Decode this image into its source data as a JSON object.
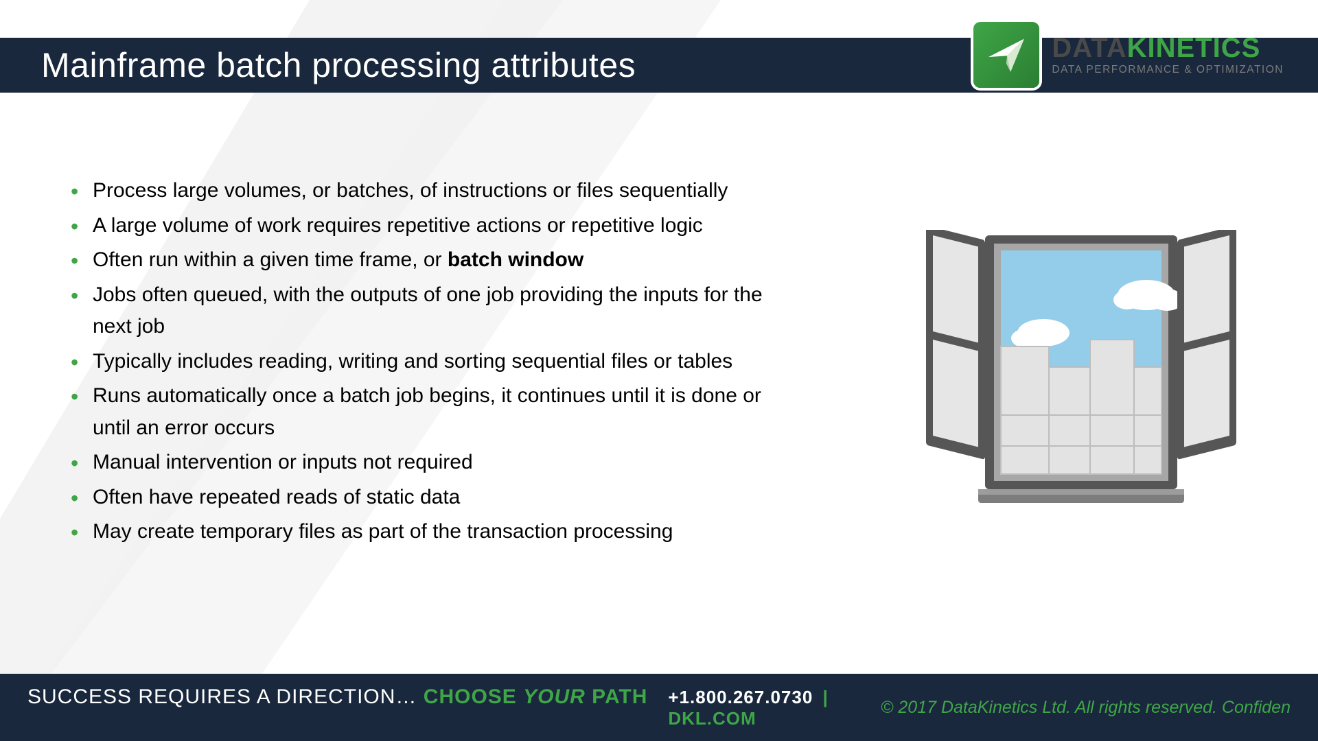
{
  "header": {
    "title": "Mainframe batch processing attributes"
  },
  "logo": {
    "name_a": "DATA",
    "name_b": "KINETICS",
    "tagline": "DATA PERFORMANCE & OPTIMIZATION"
  },
  "bullets": [
    {
      "pre": "Process large volumes, or batches, of instructions or files sequentially",
      "bold": "",
      "post": ""
    },
    {
      "pre": "A large volume of work requires repetitive actions or repetitive logic",
      "bold": "",
      "post": ""
    },
    {
      "pre": "Often run within a given time frame, or ",
      "bold": "batch window",
      "post": ""
    },
    {
      "pre": "Jobs often queued, with the outputs of one job providing the inputs for the next job",
      "bold": "",
      "post": ""
    },
    {
      "pre": "Typically includes reading, writing and sorting sequential files or tables",
      "bold": "",
      "post": ""
    },
    {
      "pre": "Runs automatically once a batch job begins, it continues until it is done or until an error occurs",
      "bold": "",
      "post": ""
    },
    {
      "pre": "Manual intervention or inputs not required",
      "bold": "",
      "post": ""
    },
    {
      "pre": "Often have repeated reads of static data",
      "bold": "",
      "post": ""
    },
    {
      "pre": "May create temporary files as part of the transaction processing",
      "bold": "",
      "post": ""
    }
  ],
  "footer": {
    "tag_white": "SUCCESS REQUIRES A DIRECTION… ",
    "tag_green1": "CHOOSE ",
    "tag_green_italic": "YOUR",
    "tag_green2": " PATH",
    "phone": "+1.800.267.0730",
    "sep": "|",
    "site": "DKL.COM",
    "copyright": "© 2017 DataKinetics Ltd.   All rights reserved.  Confiden"
  }
}
